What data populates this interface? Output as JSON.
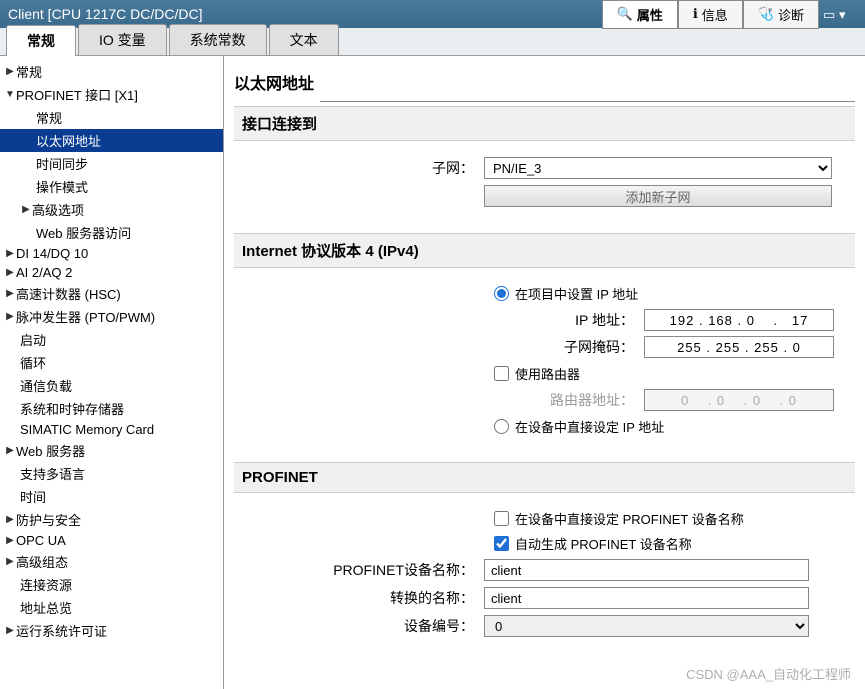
{
  "titlebar": {
    "text": "Client [CPU 1217C DC/DC/DC]"
  },
  "top_tabs": {
    "properties": "属性",
    "info": "信息",
    "diagnostics": "诊断"
  },
  "tabs": {
    "general": "常规",
    "io_vars": "IO 变量",
    "sys_const": "系统常数",
    "text": "文本"
  },
  "tree": {
    "general": "常规",
    "profinet": "PROFINET 接口 [X1]",
    "pn_general": "常规",
    "ethernet_addr": "以太网地址",
    "time_sync": "时间同步",
    "op_mode": "操作模式",
    "adv_options": "高级选项",
    "web_access": "Web 服务器访问",
    "di_dq": "DI 14/DQ 10",
    "ai_aq": "AI 2/AQ 2",
    "hsc": "高速计数器 (HSC)",
    "pto": "脉冲发生器 (PTO/PWM)",
    "startup": "启动",
    "cycle": "循环",
    "comm_load": "通信负载",
    "sys_clock": "系统和时钟存储器",
    "memory_card": "SIMATIC Memory Card",
    "web_server": "Web 服务器",
    "multilang": "支持多语言",
    "time": "时间",
    "protection": "防护与安全",
    "opc_ua": "OPC UA",
    "adv_config": "高级组态",
    "conn_res": "连接资源",
    "addr_overview": "地址总览",
    "runtime_lic": "运行系统许可证"
  },
  "content": {
    "title": "以太网地址",
    "section_connect": "接口连接到",
    "subnet_label": "子网：",
    "subnet_value": "PN/IE_3",
    "add_subnet": "添加新子网",
    "section_ipv4": "Internet 协议版本 4 (IPv4)",
    "radio_project": "在项目中设置 IP 地址",
    "ip_label": "IP 地址：",
    "ip_value": "192 . 168 . 0    .   17",
    "mask_label": "子网掩码：",
    "mask_value": "255 . 255 . 255 . 0",
    "use_router": "使用路由器",
    "router_label": "路由器地址：",
    "router_value": "0    . 0    . 0    . 0",
    "radio_device": "在设备中直接设定 IP 地址",
    "section_profinet": "PROFINET",
    "chk_device_name": "在设备中直接设定 PROFINET 设备名称",
    "chk_auto_name": "自动生成 PROFINET 设备名称",
    "pn_name_label": "PROFINET设备名称：",
    "pn_name_value": "client",
    "conv_name_label": "转换的名称：",
    "conv_name_value": "client",
    "dev_num_label": "设备编号：",
    "dev_num_value": "0"
  },
  "watermark": "CSDN @AAA_自动化工程师"
}
